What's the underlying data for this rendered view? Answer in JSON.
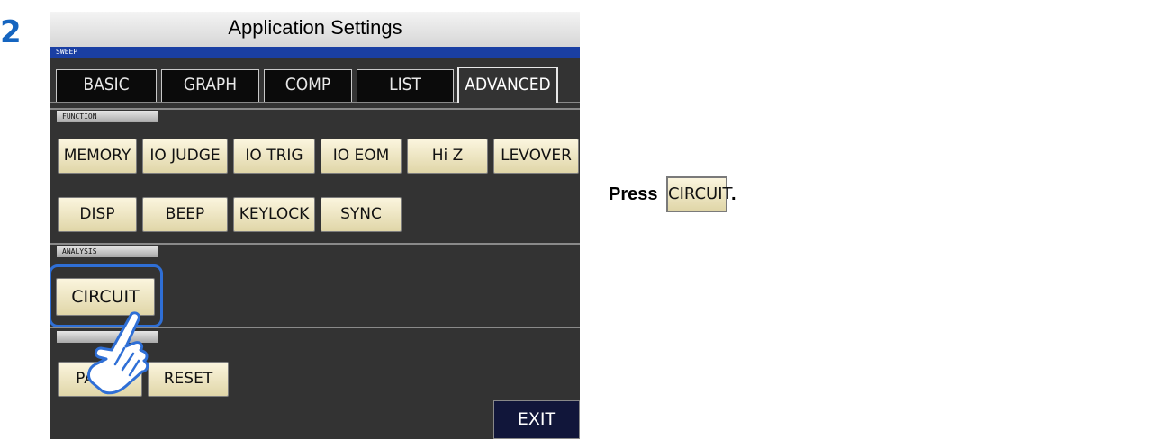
{
  "step_number": "2",
  "window": {
    "title": "Application Settings",
    "mode": "SWEEP"
  },
  "tabs": [
    {
      "label": "BASIC",
      "active": false
    },
    {
      "label": "GRAPH",
      "active": false
    },
    {
      "label": "COMP",
      "active": false
    },
    {
      "label": "LIST",
      "active": false
    },
    {
      "label": "ADVANCED",
      "active": true
    }
  ],
  "sections": {
    "function": {
      "label": "FUNCTION",
      "row1": [
        "MEMORY",
        "IO JUDGE",
        "IO TRIG",
        "IO EOM",
        "Hi Z",
        "LEVOVER"
      ],
      "row2": [
        "DISP",
        "BEEP",
        "KEYLOCK",
        "SYNC"
      ]
    },
    "analysis": {
      "label": "ANALYSIS",
      "buttons": [
        "CIRCUIT"
      ]
    },
    "setting": {
      "buttons": [
        "PANEL",
        "RESET"
      ]
    }
  },
  "exit_label": "EXIT",
  "instruction": {
    "press": "Press",
    "button": "CIRCUIT",
    "end": "."
  },
  "colors": {
    "screen_bg": "#333333",
    "title_blue": "#1a3fa3",
    "button_face": "#f4ecc8",
    "highlight": "#2f6fd6",
    "step_number": "#1565c0",
    "exit_bg": "#11163a"
  },
  "icons": {
    "pointer": "hand-pointer-icon"
  }
}
